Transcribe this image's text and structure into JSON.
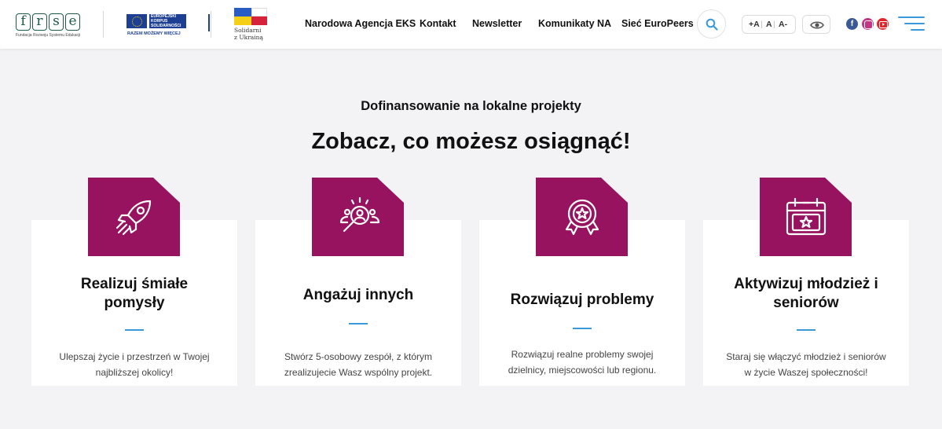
{
  "header": {
    "logo_frse": {
      "letters": [
        "f",
        "r",
        "s",
        "e"
      ],
      "subtitle": "Fundacja Rozwoju Systemu Edukacji"
    },
    "logo_eks": {
      "line1": "EUROPEJSKI",
      "line2": "KORPUS",
      "line3": "SOLIDARNOŚCI",
      "slogan": "RAZEM MOŻEMY WIĘCEJ"
    },
    "logo_ua": {
      "line1": "Solidarni",
      "line2": "z Ukrainą"
    },
    "nav": [
      "Narodowa Agencja EKS",
      "Kontakt",
      "Newsletter",
      "Komunikaty NA",
      "Sieć EuroPeers"
    ],
    "font_controls": {
      "increase": "+A",
      "normal": "A",
      "decrease": "A-"
    },
    "social": [
      "facebook",
      "instagram",
      "youtube"
    ],
    "colors": {
      "accent_blue": "#3a9ad9"
    }
  },
  "main": {
    "eyebrow": "Dofinansowanie na lokalne projekty",
    "heading": "Zobacz, co możesz osiągnąć!",
    "colors": {
      "icon_bg": "#98135f"
    },
    "cards": [
      {
        "icon": "rocket-icon",
        "title_line1": "Realizuj śmiałe",
        "title_line2": "pomysły",
        "desc_line1": "Ulepszaj życie i przestrzeń w Twojej",
        "desc_line2": "najbliższej okolicy!"
      },
      {
        "icon": "team-search-icon",
        "title_line1": "Angażuj innych",
        "title_line2": "",
        "desc_line1": "Stwórz 5-osobowy zespół, z którym",
        "desc_line2": "zrealizujecie Wasz wspólny projekt."
      },
      {
        "icon": "award-medal-icon",
        "title_line1": "Rozwiązuj problemy",
        "title_line2": "",
        "desc_line1": "Rozwiązuj realne problemy swojej",
        "desc_line2": "dzielnicy, miejscowości lub regionu."
      },
      {
        "icon": "calendar-star-icon",
        "title_line1": "Aktywizuj młodzież i",
        "title_line2": "seniorów",
        "desc_line1": "Staraj się włączyć młodzież i seniorów",
        "desc_line2": "w życie Waszej społeczności!"
      }
    ]
  }
}
